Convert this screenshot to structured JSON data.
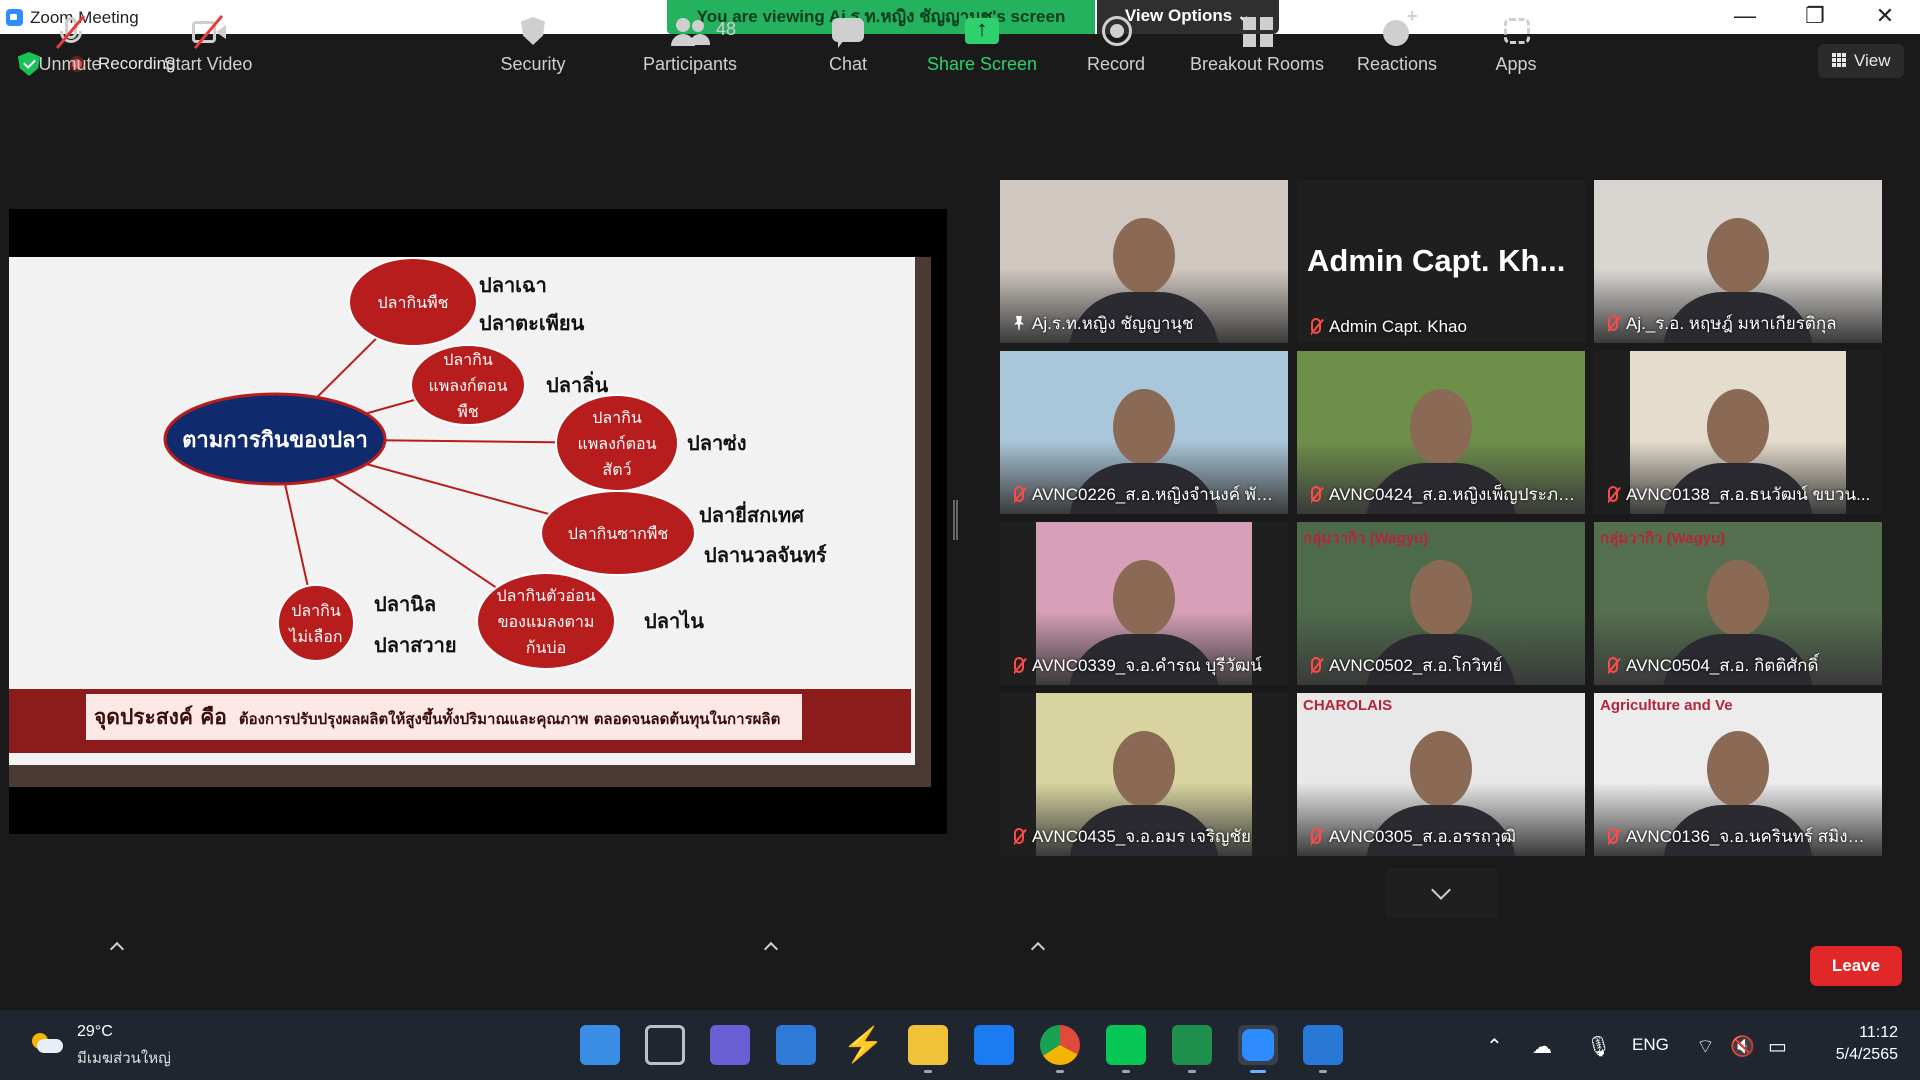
{
  "window": {
    "title": "Zoom Meeting",
    "viewing_banner": "You are viewing Aj.ร.ท.หญิง ชัญญานุช's screen",
    "view_options": "View Options ⌄",
    "controls": {
      "minimize": "—",
      "restore": "❐",
      "close": "✕"
    }
  },
  "meeting_bar": {
    "recording_label": "Recording",
    "view_label": "View"
  },
  "slide": {
    "center": "ตามการกินของปลา",
    "categories": [
      {
        "label_lines": [
          "ปลากินพืช"
        ],
        "fish": [
          "ปลาเฉา",
          "ปลาตะเพียน"
        ]
      },
      {
        "label_lines": [
          "ปลากิน",
          "แพลงก์ตอน",
          "พืช"
        ],
        "fish": [
          "ปลาลิ่น"
        ]
      },
      {
        "label_lines": [
          "ปลากิน",
          "แพลงก์ตอน",
          "สัตว์"
        ],
        "fish": [
          "ปลาซ่ง"
        ]
      },
      {
        "label_lines": [
          "ปลากินซากพืช"
        ],
        "fish": [
          "ปลายี่สกเทศ",
          "ปลานวลจันทร์"
        ]
      },
      {
        "label_lines": [
          "ปลากินตัวอ่อน",
          "ของแมลงตาม",
          "ก้นบ่อ"
        ],
        "fish": [
          "ปลาไน"
        ]
      },
      {
        "label_lines": [
          "ปลากิน",
          "ไม่เลือก"
        ],
        "fish": [
          "ปลานิล",
          "ปลาสวาย"
        ]
      }
    ],
    "purpose_heading": "จุดประสงค์ คือ",
    "purpose_text": "ต้องการปรับปรุงผลผลิตให้สูงขึ้นทั้งปริมาณและคุณภาพ ตลอดจนลดต้นทุนในการผลิต"
  },
  "participants": [
    {
      "name": "Aj.ร.ท.หญิง ชัญญานุช",
      "muted": false,
      "pinned": true,
      "active": true,
      "bg": "#cfc7c0",
      "video": true
    },
    {
      "name": "Admin Capt. Khao",
      "muted": true,
      "pinned": false,
      "active": false,
      "bg": "#1f1f1f",
      "video": false,
      "display_name": "Admin Capt. Kh..."
    },
    {
      "name": "Aj._ร.อ. หฤษฎ์ มหาเกียรติกุล",
      "muted": true,
      "pinned": false,
      "active": false,
      "bg": "#d9d6d2",
      "video": true
    },
    {
      "name": "AVNC0226_ส.อ.หญิงจำนงค์ พัด...",
      "muted": true,
      "pinned": false,
      "active": false,
      "bg": "#a9c6da",
      "video": true
    },
    {
      "name": "AVNC0424_ส.อ.หญิงเพ็ญประภา...",
      "muted": true,
      "pinned": false,
      "active": false,
      "bg": "#6e8f4a",
      "video": true
    },
    {
      "name": "AVNC0138_ส.อ.ธนวัฒน์ ขบวน...",
      "muted": true,
      "pinned": false,
      "active": false,
      "bg": "#e4dccd",
      "video": true
    },
    {
      "name": "AVNC0339_จ.อ.คำรณ บุรีวัฒน์",
      "muted": true,
      "pinned": false,
      "active": false,
      "bg": "#d8a0b8",
      "video": true
    },
    {
      "name": "AVNC0502_ส.อ.โกวิทย์",
      "muted": true,
      "pinned": false,
      "active": false,
      "bg": "#4d6b4a",
      "video": true,
      "overlay": "กลุ่มวากิว (Wagyu)"
    },
    {
      "name": "AVNC0504_ส.อ. กิตติศักดิ์",
      "muted": true,
      "pinned": false,
      "active": false,
      "bg": "#55704e",
      "video": true,
      "overlay": "กลุ่มวากิว (Wagyu)"
    },
    {
      "name": "AVNC0435_จ.อ.อมร เจริญชัย",
      "muted": true,
      "pinned": false,
      "active": false,
      "bg": "#d8d4a0",
      "video": true
    },
    {
      "name": "AVNC0305_ส.อ.อรรถวุฒิ",
      "muted": true,
      "pinned": false,
      "active": false,
      "bg": "#e8e8e8",
      "video": true,
      "overlay": "CHAROLAIS"
    },
    {
      "name": "AVNC0136_จ.อ.นครินทร์ สมิงแก้ว",
      "muted": true,
      "pinned": false,
      "active": false,
      "bg": "#ececec",
      "video": true,
      "overlay": "Agriculture and Ve"
    }
  ],
  "toolbar": {
    "unmute": "Unmute",
    "start_video": "Start Video",
    "security": "Security",
    "participants_count": "48",
    "participants": "Participants",
    "chat": "Chat",
    "share_screen": "Share Screen",
    "record": "Record",
    "breakout_rooms": "Breakout Rooms",
    "reactions": "Reactions",
    "apps": "Apps",
    "leave": "Leave"
  },
  "taskbar": {
    "temperature": "29°C",
    "weather_desc": "มีเมฆส่วนใหญ่",
    "language": "ENG",
    "time": "11:12",
    "date": "5/4/2565",
    "apps": [
      {
        "name": "start-icon",
        "color": "#3a8ee6"
      },
      {
        "name": "task-view-icon",
        "color": "#b8c0cc"
      },
      {
        "name": "teams-chat-icon",
        "color": "#6b5fd6"
      },
      {
        "name": "mail-icon",
        "color": "#2f7ad6"
      },
      {
        "name": "app-s-icon",
        "color": "#e8e8e8"
      },
      {
        "name": "file-explorer-icon",
        "color": "#f0c23a"
      },
      {
        "name": "dropbox-icon",
        "color": "#1a7cf0"
      },
      {
        "name": "chrome-icon",
        "color": "#e04a3a"
      },
      {
        "name": "line-icon",
        "color": "#06c755"
      },
      {
        "name": "excel-icon",
        "color": "#1f8f4c"
      },
      {
        "name": "zoom-icon",
        "color": "#2d8cff"
      },
      {
        "name": "photos-icon",
        "color": "#2a78d6"
      }
    ]
  },
  "colors": {
    "accent_green": "#25b25f",
    "active_border": "#c4e83a",
    "leave_red": "#e02828",
    "slide_red": "#b81d1d",
    "slide_navy": "#102a6e"
  }
}
